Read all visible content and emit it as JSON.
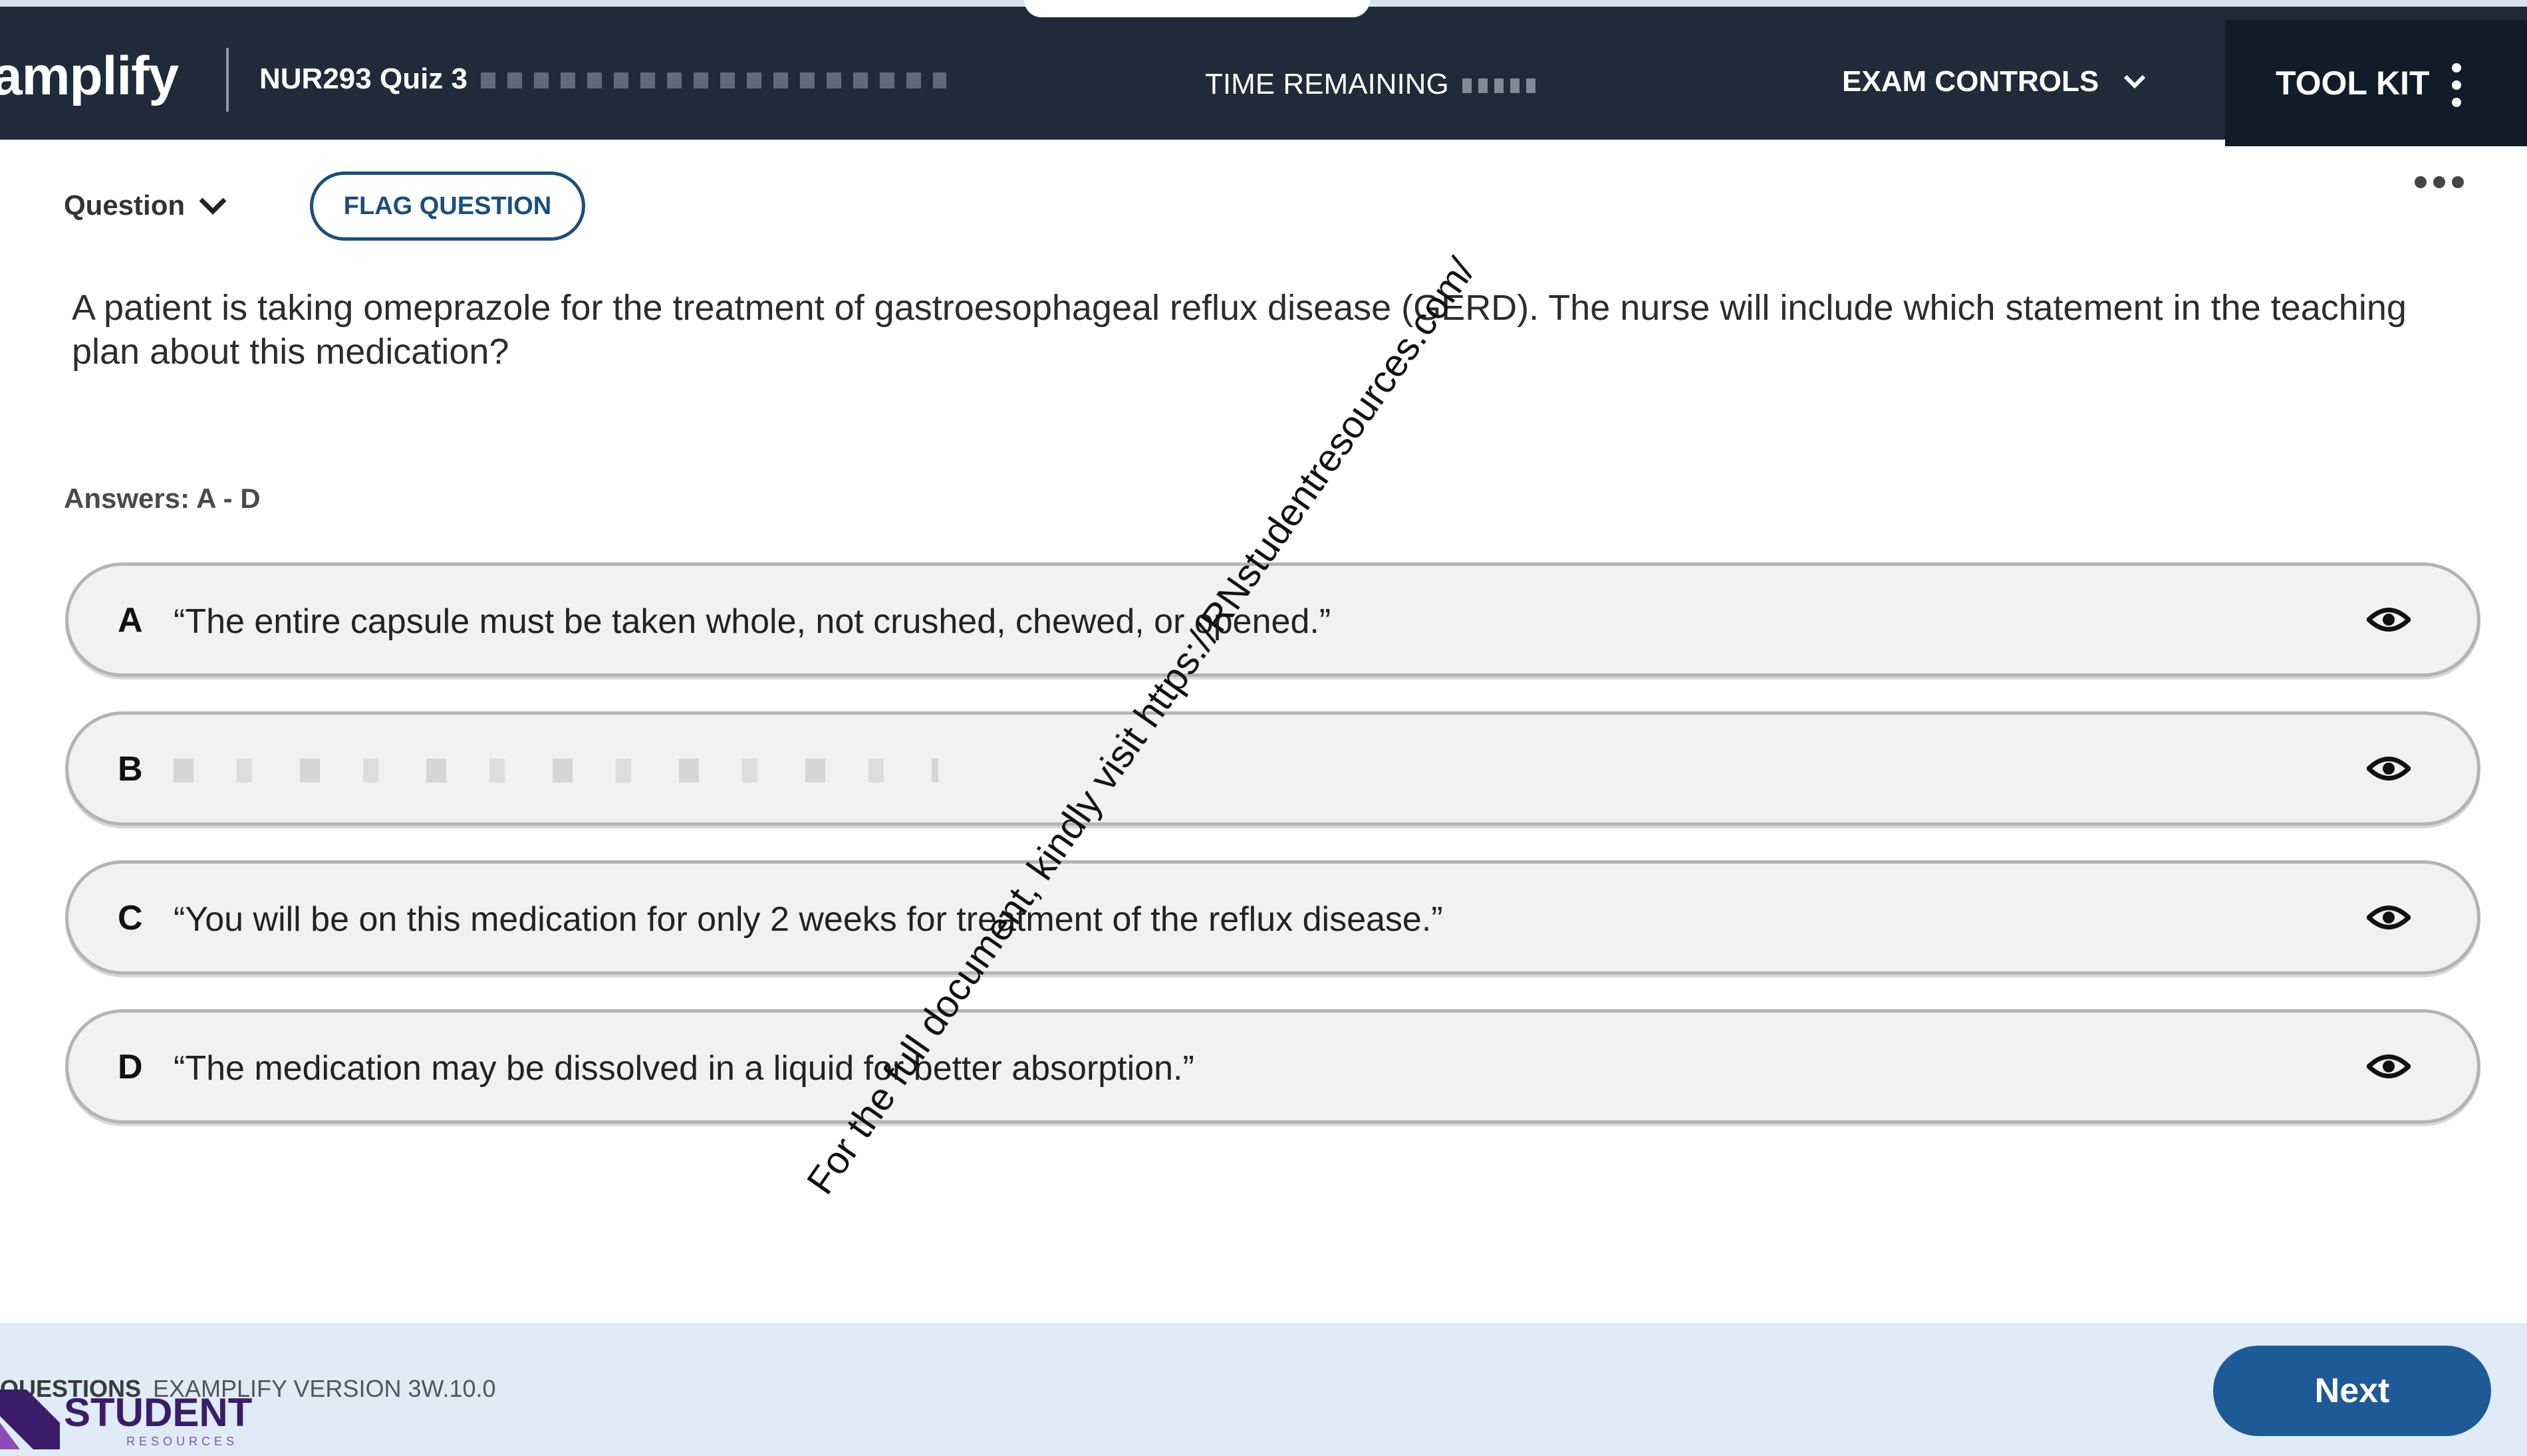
{
  "header": {
    "logo": "amplify",
    "exam_title": "NUR293 Quiz 3",
    "time_remaining_label": "TIME REMAINING",
    "exam_controls_label": "EXAM CONTROLS",
    "toolkit_label": "TOOL KIT"
  },
  "question_bar": {
    "question_label": "Question",
    "flag_label": "FLAG QUESTION"
  },
  "question": {
    "text": "A patient is taking omeprazole for the treatment of gastroesophageal reflux disease (GERD). The nurse will include which statement in the teaching plan about this medication?",
    "answers_range": "Answers: A - D"
  },
  "options": [
    {
      "letter": "A",
      "text": "“The entire capsule must be taken whole, not crushed, chewed, or opened.”"
    },
    {
      "letter": "B",
      "text": ""
    },
    {
      "letter": "C",
      "text": "“You will be on this medication for only 2 weeks for treatment of the reflux disease.”"
    },
    {
      "letter": "D",
      "text": "“The medication may be dissolved in a liquid for better absorption.”"
    }
  ],
  "overlay": {
    "promo_text": "For the full document, kindly visit https://RNstudentresources.com/"
  },
  "footer": {
    "questions_label": "QUESTIONS",
    "version_text": "EXAMPLIFY VERSION 3W.10.0",
    "next_label": "Next",
    "brand_name": "STUDENT",
    "brand_sub": "RESOURCES"
  },
  "colors": {
    "header_bg": "#1f2b3a",
    "toolkit_bg": "#111c29",
    "accent": "#1e5a96",
    "footer_bg": "#dfebf6"
  }
}
